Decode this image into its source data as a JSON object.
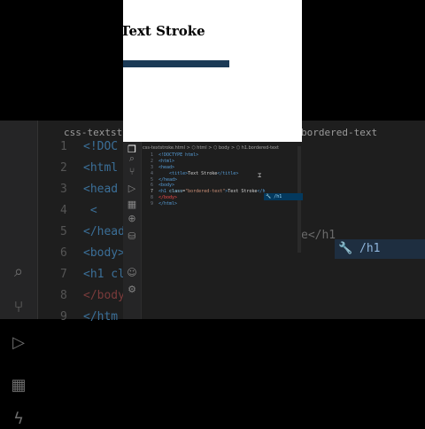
{
  "browser": {
    "heading": "Text Stroke"
  },
  "vscode": {
    "breadcrumb": "css-textstroke.html > ⬡ html > ⬡ body > ⬡ h1.bordered-text",
    "active_line": 7,
    "lines": [
      {
        "n": "1",
        "html": "<span class='t'>&lt;!DOCTYPE html&gt;</span>"
      },
      {
        "n": "2",
        "html": "<span class='t'>&lt;html&gt;</span>"
      },
      {
        "n": "3",
        "html": "<span class='t'>&lt;head&gt;</span>"
      },
      {
        "n": "4",
        "html": "&nbsp;&nbsp;&nbsp;&nbsp;<span class='t'>&lt;title&gt;</span><span class='tx'>Text Stroke</span><span class='t'>&lt;/title&gt;</span>"
      },
      {
        "n": "5",
        "html": "<span class='t'>&lt;/head&gt;</span>"
      },
      {
        "n": "6",
        "html": "<span class='t'>&lt;body&gt;</span>"
      },
      {
        "n": "7",
        "html": "<span class='t'>&lt;h1 </span><span class='a'>class</span><span class='tx'>=</span><span class='s'>\"bordered-text\"</span><span class='t'>&gt;</span><span class='tx'>Text Stroke</span><span class='t'>&lt;/h</span>"
      },
      {
        "n": "8",
        "html": "<span class='tr'>&lt;/body&gt;</span>"
      },
      {
        "n": "9",
        "html": "<span class='t'>&lt;/html&gt;</span>"
      }
    ],
    "suggestion": "/h1"
  },
  "background": {
    "file_title": "css-textstroke",
    "file_title_right": "bordered-text",
    "lines": [
      {
        "n": "1",
        "text": "<!DOC"
      },
      {
        "n": "2",
        "text": "<html"
      },
      {
        "n": "3",
        "text": "<head"
      },
      {
        "n": "4",
        "text": "    <"
      },
      {
        "n": "5",
        "text": "</head"
      },
      {
        "n": "6",
        "text": "<body>"
      },
      {
        "n": "7",
        "text": "<h1 cl"
      },
      {
        "n": "8",
        "text": "</body"
      },
      {
        "n": "9",
        "text": "</htm"
      }
    ],
    "right_fragment": "e</h1",
    "suggestion": "/h1"
  }
}
